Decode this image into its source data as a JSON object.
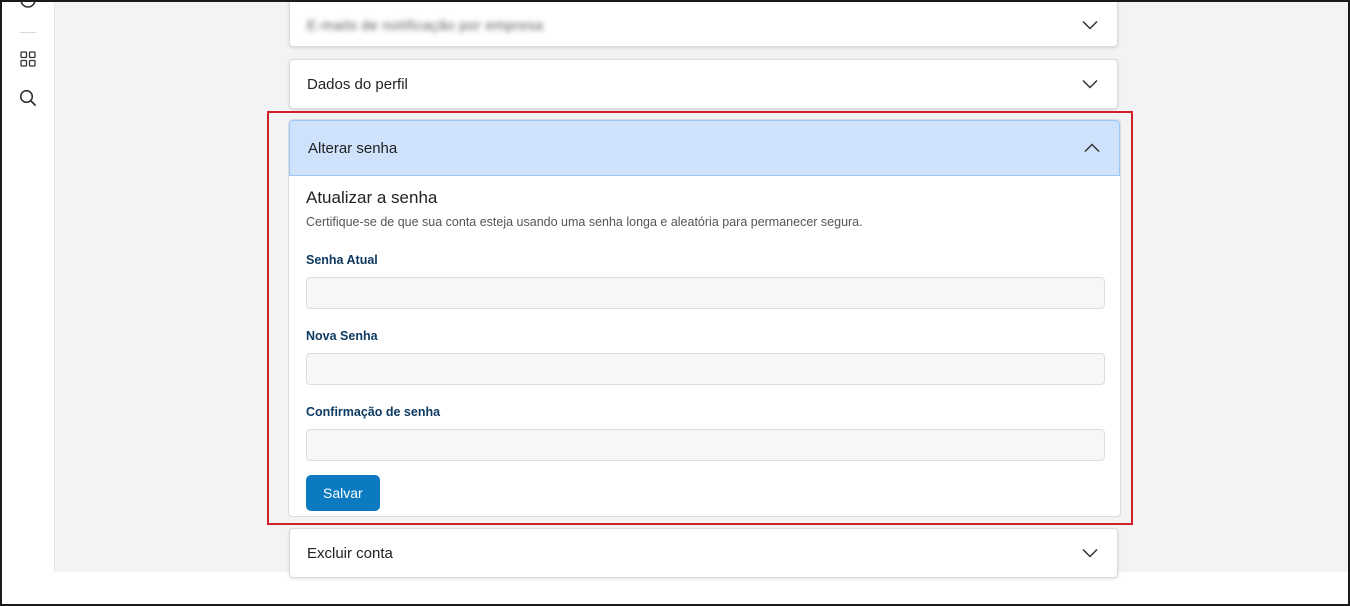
{
  "sidebar": {
    "icons": [
      "circle-icon",
      "grid-icon",
      "search-icon"
    ]
  },
  "sections": {
    "top_blurred": {
      "label": "E-mails de notificação por empresa"
    },
    "profile": {
      "title": "Dados do perfil"
    },
    "password": {
      "title": "Alterar senha",
      "heading": "Atualizar a senha",
      "description": "Certifique-se de que sua conta esteja usando uma senha longa e aleatória para permanecer segura.",
      "current_label": "Senha Atual",
      "current_value": "",
      "new_label": "Nova Senha",
      "new_value": "",
      "confirm_label": "Confirmação de senha",
      "confirm_value": "",
      "save_label": "Salvar"
    },
    "delete": {
      "title": "Excluir conta"
    }
  },
  "colors": {
    "accent": "#0b7ac1",
    "open_header_bg": "#cfe2fb",
    "label": "#0e3a61",
    "highlight": "#d0202a"
  }
}
